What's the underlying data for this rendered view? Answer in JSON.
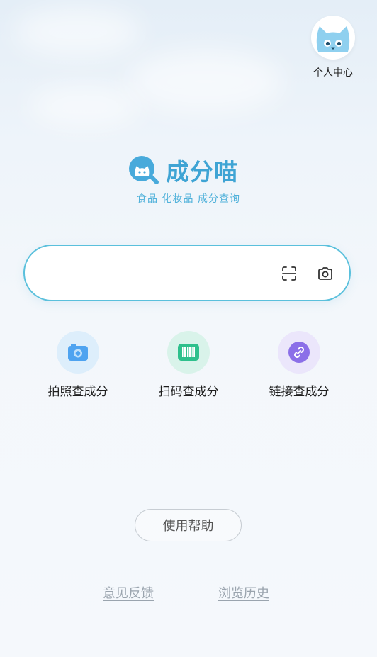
{
  "profile": {
    "label": "个人中心",
    "icon": "cat-avatar-icon"
  },
  "brand": {
    "name": "成分喵",
    "tagline": "食品 化妆品 成分查询",
    "color": "#3fa4d4",
    "logo_icon": "cat-magnifier-logo-icon"
  },
  "search": {
    "value": "",
    "placeholder": "",
    "scan_icon": "scan-icon",
    "camera_icon": "camera-icon",
    "border_color": "#5ac0dc"
  },
  "actions": [
    {
      "label": "拍照查成分",
      "icon": "camera-icon",
      "color": "#4ea3f0"
    },
    {
      "label": "扫码查成分",
      "icon": "barcode-icon",
      "color": "#2ec08c"
    },
    {
      "label": "链接查成分",
      "icon": "link-icon",
      "color": "#8b6fe8"
    }
  ],
  "help": {
    "label": "使用帮助"
  },
  "footer": {
    "feedback": "意见反馈",
    "history": "浏览历史"
  }
}
